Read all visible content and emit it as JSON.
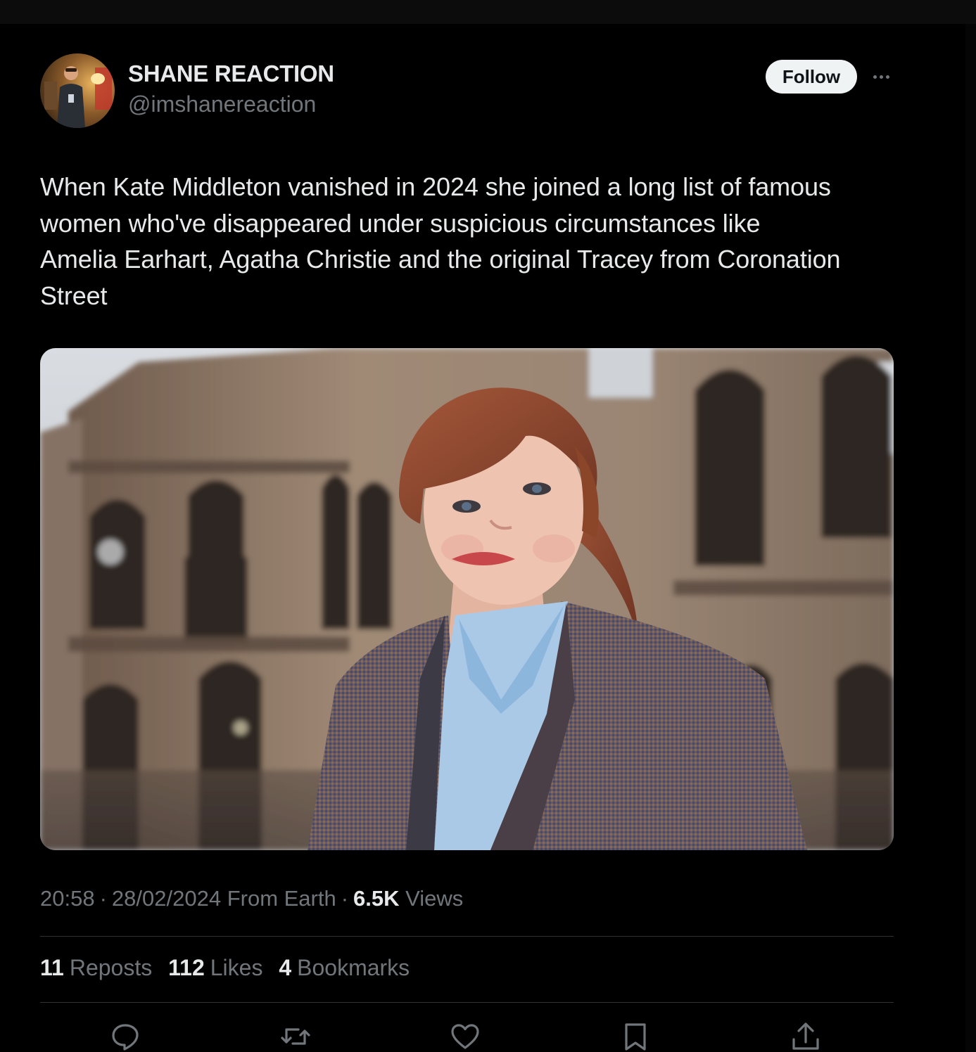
{
  "author": {
    "display_name": "SHANE REACTION",
    "handle": "@imshanereaction",
    "avatar_icon": "profile-photo"
  },
  "header": {
    "follow_label": "Follow",
    "more_icon": "more-horizontal-icon"
  },
  "tweet": {
    "text_lines": [
      "When Kate Middleton vanished in 2024 she joined a long list of famous",
      "women who've disappeared under suspicious circumstances like",
      "Amelia Earhart, Agatha Christie and the original Tracey from Coronation",
      "Street"
    ],
    "media_icon": "attached-photo"
  },
  "meta": {
    "time": "20:58",
    "date": "28/02/2024",
    "source": "From Earth",
    "separator": "·",
    "views_count": "6.5K",
    "views_label": "Views"
  },
  "stats": {
    "reposts_count": "11",
    "reposts_label": "Reposts",
    "likes_count": "112",
    "likes_label": "Likes",
    "bookmarks_count": "4",
    "bookmarks_label": "Bookmarks"
  },
  "actions": {
    "icons": [
      "reply-icon",
      "repost-icon",
      "like-icon",
      "bookmark-icon",
      "share-icon"
    ]
  },
  "colors": {
    "background": "#000000",
    "primary_text": "#e7e9ea",
    "secondary_text": "#71767b",
    "divider": "#2f3336",
    "follow_button_bg": "#eff3f4"
  }
}
